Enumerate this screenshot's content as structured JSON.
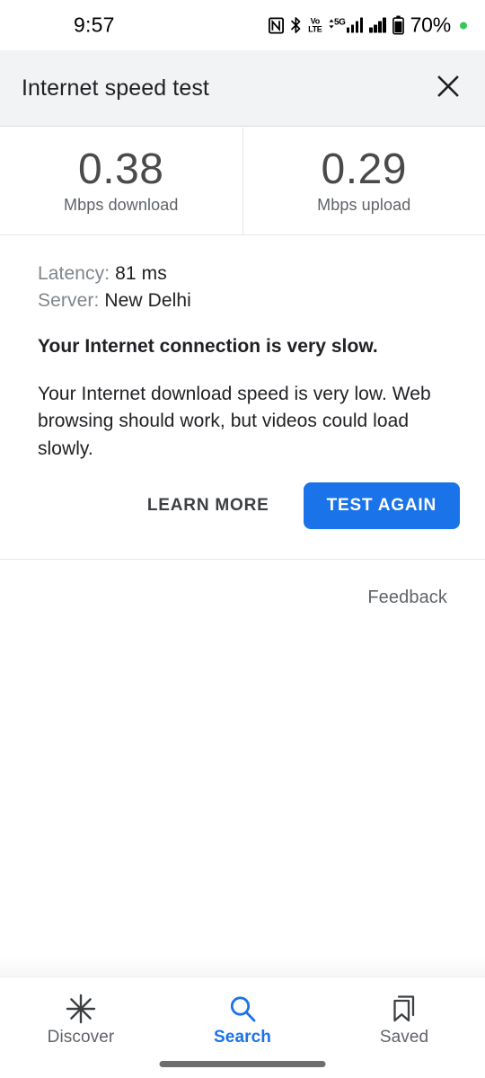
{
  "status_bar": {
    "time": "9:57",
    "battery_percent": "70%",
    "icons": [
      "nfc-icon",
      "bluetooth-icon",
      "volte-icon",
      "5g-signal-icon",
      "signal-bars-icon",
      "battery-icon",
      "recording-dot-icon"
    ],
    "volte_top": "Vo",
    "volte_bottom": "LTE",
    "network_type": "5G"
  },
  "header": {
    "title": "Internet speed test",
    "close_icon": "close-icon"
  },
  "speeds": [
    {
      "value": "0.38",
      "label": "Mbps download"
    },
    {
      "value": "0.29",
      "label": "Mbps upload"
    }
  ],
  "details": {
    "latency_label": "Latency:",
    "latency_value": "81 ms",
    "server_label": "Server:",
    "server_value": "New Delhi"
  },
  "verdict": "Your Internet connection is very slow.",
  "explanation": "Your Internet download speed is very low. Web browsing should work, but videos could load slowly.",
  "actions": {
    "learn_more": "LEARN MORE",
    "test_again": "TEST AGAIN"
  },
  "feedback": "Feedback",
  "bottom_nav": [
    {
      "label": "Discover",
      "icon": "asterisk-icon",
      "active": false
    },
    {
      "label": "Search",
      "icon": "search-icon",
      "active": true
    },
    {
      "label": "Saved",
      "icon": "bookmark-stack-icon",
      "active": false
    }
  ],
  "colors": {
    "accent": "#1a73e8",
    "header_bg": "#f1f3f4",
    "text_primary": "#202124",
    "text_secondary": "#5f6368",
    "battery_dot": "#34c759"
  }
}
